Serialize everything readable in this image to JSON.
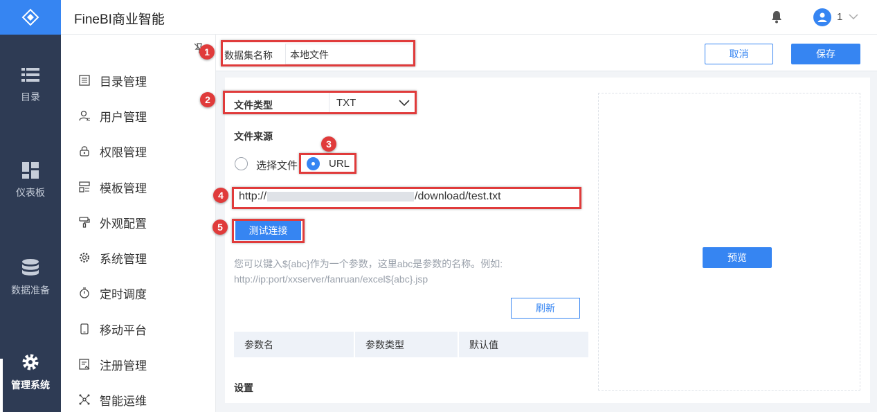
{
  "app": {
    "title": "FineBI商业智能",
    "user_name": "1",
    "brand_color": "#3685f2"
  },
  "leftnav": {
    "items": [
      {
        "label": "目录",
        "icon": "list-icon"
      },
      {
        "label": "仪表板",
        "icon": "dashboard-icon"
      },
      {
        "label": "数据准备",
        "icon": "database-icon"
      },
      {
        "label": "管理系统",
        "icon": "gear-icon",
        "active": true
      }
    ]
  },
  "submenu": {
    "items": [
      {
        "label": "目录管理",
        "icon": "catalog-icon"
      },
      {
        "label": "用户管理",
        "icon": "user-icon"
      },
      {
        "label": "权限管理",
        "icon": "lock-icon"
      },
      {
        "label": "模板管理",
        "icon": "template-icon"
      },
      {
        "label": "外观配置",
        "icon": "paint-roller-icon"
      },
      {
        "label": "系统管理",
        "icon": "settings-icon"
      },
      {
        "label": "定时调度",
        "icon": "timer-icon"
      },
      {
        "label": "移动平台",
        "icon": "mobile-icon"
      },
      {
        "label": "注册管理",
        "icon": "register-icon"
      },
      {
        "label": "智能运维",
        "icon": "network-icon"
      }
    ]
  },
  "header": {
    "dataset_name_label": "数据集名称",
    "dataset_name_value": "本地文件",
    "cancel_label": "取消",
    "save_label": "保存"
  },
  "form": {
    "file_type_label": "文件类型",
    "file_type_value": "TXT",
    "file_source_label": "文件来源",
    "source_options": [
      "选择文件",
      "URL"
    ],
    "source_selected": "URL",
    "url_prefix": "http://",
    "url_suffix": "/download/test.txt",
    "test_button": "测试连接",
    "hint": "您可以键入${abc}作为一个参数，这里abc是参数的名称。例如: http://ip:port/xxserver/fanruan/excel${abc}.jsp",
    "refresh_button": "刷新",
    "param_columns": [
      "参数名",
      "参数类型",
      "默认值"
    ],
    "settings_label": "设置"
  },
  "preview": {
    "button": "预览"
  },
  "annotations": [
    "1",
    "2",
    "3",
    "4",
    "5"
  ],
  "annotation_color": "#e03b3b"
}
